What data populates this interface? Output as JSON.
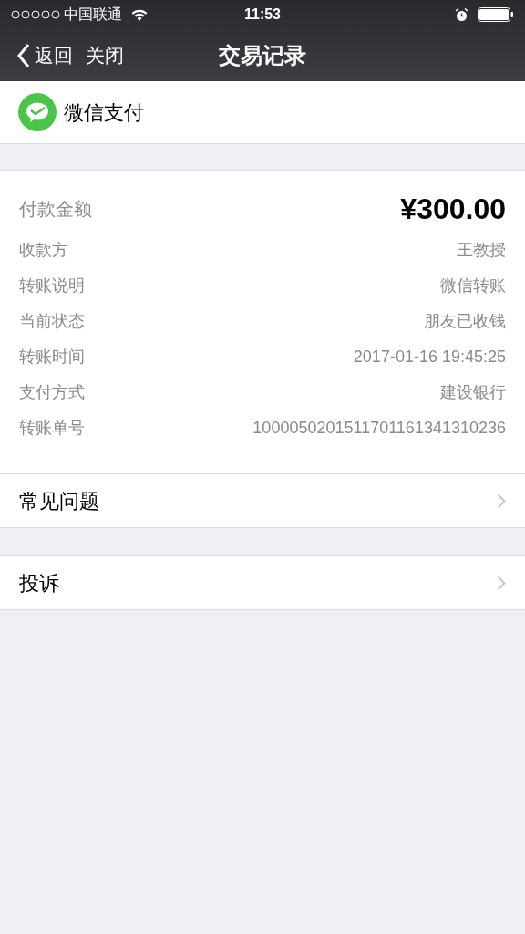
{
  "status_bar": {
    "carrier": "中国联通",
    "time": "11:53"
  },
  "nav": {
    "back": "返回",
    "close": "关闭",
    "title": "交易记录"
  },
  "merchant": {
    "name": "微信支付"
  },
  "amount": {
    "label": "付款金额",
    "value": "¥300.00"
  },
  "details": [
    {
      "label": "收款方",
      "value": "王教授"
    },
    {
      "label": "转账说明",
      "value": "微信转账"
    },
    {
      "label": "当前状态",
      "value": "朋友已收钱"
    },
    {
      "label": "转账时间",
      "value": "2017-01-16 19:45:25"
    },
    {
      "label": "支付方式",
      "value": "建设银行"
    },
    {
      "label": "转账单号",
      "value": "1000050201511701161341310236"
    }
  ],
  "menu_groups": [
    [
      "常见问题"
    ],
    [
      "投诉"
    ]
  ]
}
